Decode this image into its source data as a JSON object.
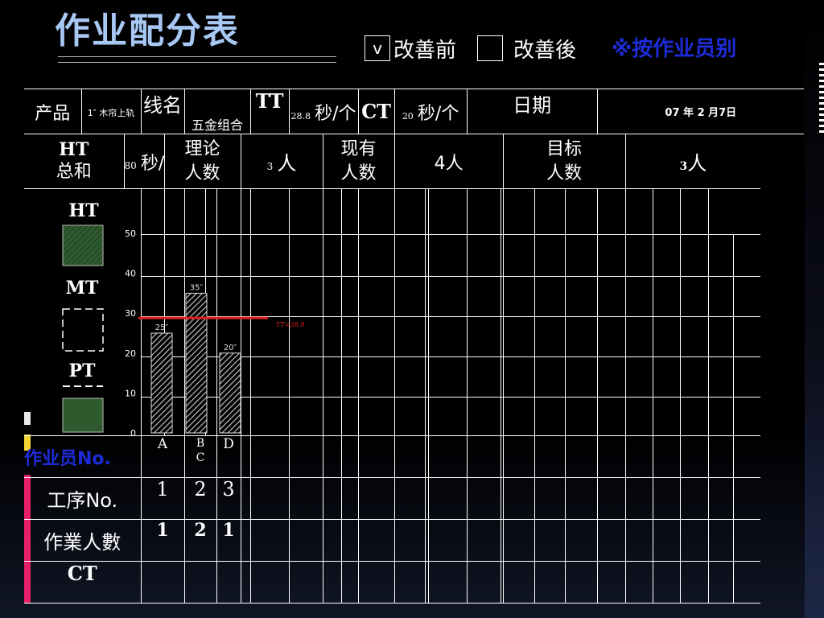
{
  "title": "作业配分表",
  "options": {
    "check_mark": "v",
    "before_label": "改善前",
    "after_label": "改善後"
  },
  "note": "※按作业员别",
  "header_row1": {
    "product_label": "产品",
    "product_value": "1″ 木帘上轨",
    "line_label": "线名",
    "line_value": "五金组合",
    "tt_label": "TT",
    "tt_value": "28.8",
    "tt_unit": "秒/个",
    "ct_label": "CT",
    "ct_value": "20",
    "ct_unit": "秒/个",
    "date_label": "日期",
    "date_value": "07 年 2 月7日"
  },
  "header_row2": {
    "ht_total_label_1": "HT",
    "ht_total_label_2": "总和",
    "ht_total_value": "80",
    "ht_total_unit": "秒/个",
    "theory_label_1": "理论",
    "theory_label_2": "人数",
    "theory_value": "3",
    "theory_unit": "人",
    "current_label_1": "现有",
    "current_label_2": "人数",
    "current_value": "4人",
    "target_label_1": "目标",
    "target_label_2": "人数",
    "target_value": "3",
    "target_unit": "人"
  },
  "legend": {
    "ht": "HT",
    "mt": "MT",
    "pt": "PT"
  },
  "colors": {
    "ht_fill": "#2e5a2e",
    "tt_line": "#e02020",
    "note": "#1e2bd8",
    "title": "#a8c8f4",
    "operator_label": "#1e2bd8"
  },
  "chart_data": {
    "type": "bar",
    "categories": [
      "A",
      "BC",
      "D"
    ],
    "values": [
      25,
      35,
      20
    ],
    "data_labels": [
      "25″",
      "35″",
      "20″"
    ],
    "ylim": [
      0,
      50
    ],
    "yticks": [
      "0",
      "10",
      "20",
      "30",
      "40",
      "50"
    ],
    "reference_line": {
      "value": 28.8,
      "label": "TT=28.8"
    },
    "bar_fill": "hatched"
  },
  "rows": {
    "operator_label": "作业员No.",
    "operators": [
      "A",
      "B",
      "D"
    ],
    "operator_b_line2": "C",
    "process_label": "工序No.",
    "process_values": [
      "1",
      "2",
      "3"
    ],
    "workers_label": "作業人數",
    "workers_values": [
      "1",
      "2",
      "1"
    ],
    "ct_label": "CT"
  }
}
